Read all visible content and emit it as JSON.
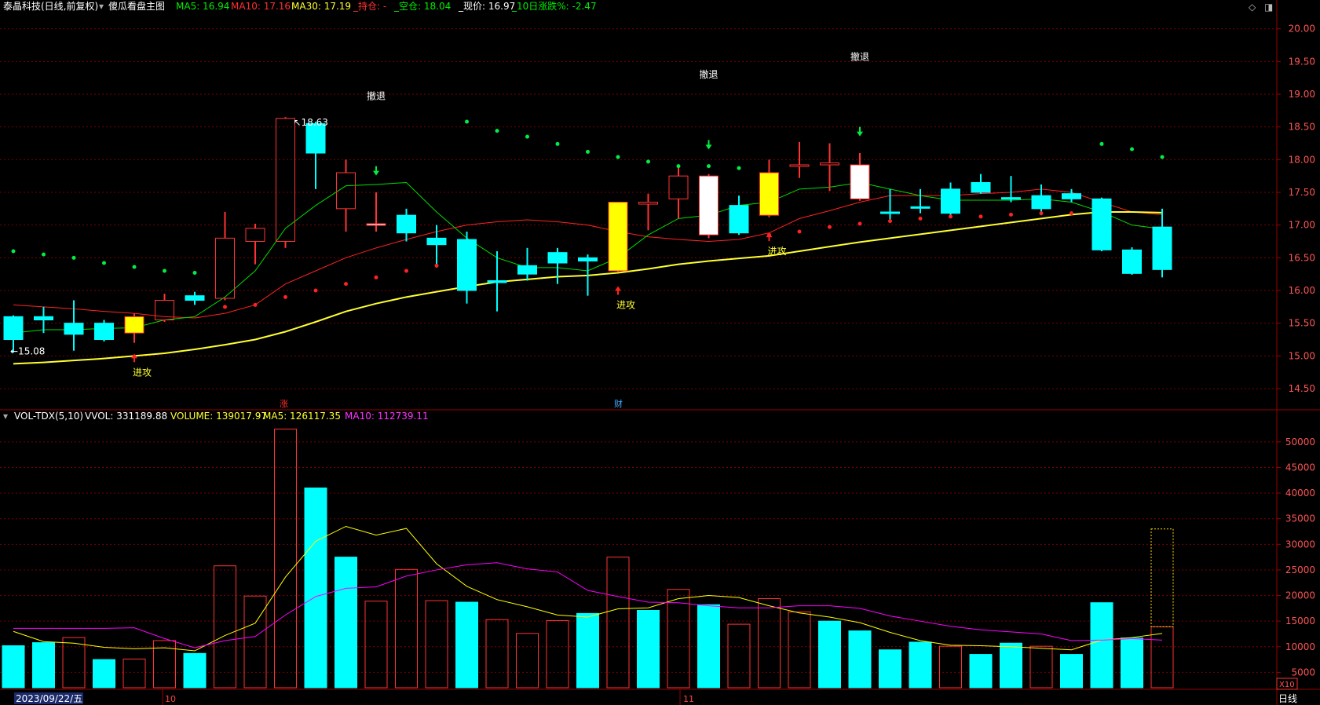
{
  "header": {
    "stock_name": "泰晶科技(日线,前复权)",
    "indicator_name": "傻瓜看盘主图",
    "ma5": "MA5: 16.94",
    "ma10": "MA10: 17.16",
    "ma30": "MA30: 17.19",
    "hold": "_持仓: -",
    "short": "_空仓: 18.04",
    "price": "_现价: 16.97",
    "change10": "_10日涨跌%: -2.47"
  },
  "volume_header": {
    "name": "VOL-TDX(5,10)",
    "vvol": "VVOL: 331189.88",
    "volume": "VOLUME: 139017.97",
    "ma5": "MA5: 126117.35",
    "ma10": "MA10: 112739.11"
  },
  "x_labels": {
    "date": "2023/09/22/五",
    "oct": "10",
    "nov": "11"
  },
  "period_label": "日线",
  "scale_label": "X10",
  "markers": {
    "zhang": "涨",
    "cai": "财"
  },
  "colors": {
    "up": "#ff3333",
    "down": "#00ffff",
    "ma5": "#00dd00",
    "ma10": "#ff2222",
    "ma30": "#ffff33",
    "vol_ma5": "#ffff00",
    "vol_ma10": "#ff00ff",
    "grid": "#7a0000",
    "text": "#ffffff"
  },
  "chart_data": [
    {
      "type": "candlestick",
      "ylim": [
        14.2,
        20.2
      ],
      "yticks": [
        "20.00",
        "19.50",
        "19.00",
        "18.50",
        "18.00",
        "17.50",
        "17.00",
        "16.50",
        "16.00",
        "15.50",
        "15.00",
        "14.50"
      ],
      "candles": [
        {
          "o": 15.6,
          "h": 15.62,
          "l": 15.05,
          "c": 15.25,
          "hl": "down"
        },
        {
          "o": 15.6,
          "h": 15.75,
          "l": 15.35,
          "c": 15.55,
          "hl": "down"
        },
        {
          "o": 15.5,
          "h": 15.85,
          "l": 15.08,
          "c": 15.33,
          "hl": "down"
        },
        {
          "o": 15.5,
          "h": 15.55,
          "l": 15.22,
          "c": 15.25,
          "hl": "down"
        },
        {
          "o": 15.35,
          "h": 15.65,
          "l": 15.2,
          "c": 15.6,
          "hl": "yellow"
        },
        {
          "o": 15.55,
          "h": 15.95,
          "l": 15.52,
          "c": 15.85,
          "hl": "up"
        },
        {
          "o": 15.92,
          "h": 15.98,
          "l": 15.78,
          "c": 15.85,
          "hl": "down"
        },
        {
          "o": 15.88,
          "h": 17.2,
          "l": 15.85,
          "c": 16.8,
          "hl": "up"
        },
        {
          "o": 16.75,
          "h": 17.02,
          "l": 16.4,
          "c": 16.95,
          "hl": "up"
        },
        {
          "o": 16.75,
          "h": 18.65,
          "l": 16.65,
          "c": 18.63,
          "hl": "up"
        },
        {
          "o": 18.55,
          "h": 18.58,
          "l": 17.55,
          "c": 18.1,
          "hl": "down"
        },
        {
          "o": 17.25,
          "h": 18.0,
          "l": 16.9,
          "c": 17.8,
          "hl": "up"
        },
        {
          "o": 17.02,
          "h": 17.5,
          "l": 16.9,
          "c": 17.02,
          "hl": "white"
        },
        {
          "o": 17.15,
          "h": 17.25,
          "l": 16.75,
          "c": 16.88,
          "hl": "down"
        },
        {
          "o": 16.8,
          "h": 17.0,
          "l": 16.35,
          "c": 16.7,
          "hl": "down"
        },
        {
          "o": 16.78,
          "h": 16.9,
          "l": 15.8,
          "c": 16.0,
          "hl": "down"
        },
        {
          "o": 16.15,
          "h": 16.6,
          "l": 15.68,
          "c": 16.12,
          "hl": "down"
        },
        {
          "o": 16.38,
          "h": 16.65,
          "l": 16.15,
          "c": 16.25,
          "hl": "down"
        },
        {
          "o": 16.58,
          "h": 16.65,
          "l": 16.1,
          "c": 16.42,
          "hl": "down"
        },
        {
          "o": 16.5,
          "h": 16.55,
          "l": 15.92,
          "c": 16.45,
          "hl": "down"
        },
        {
          "o": 16.3,
          "h": 17.35,
          "l": 16.28,
          "c": 17.35,
          "hl": "yellow"
        },
        {
          "o": 17.35,
          "h": 17.48,
          "l": 16.92,
          "c": 17.32,
          "hl": "up"
        },
        {
          "o": 17.4,
          "h": 17.9,
          "l": 17.1,
          "c": 17.75,
          "hl": "up"
        },
        {
          "o": 17.75,
          "h": 17.78,
          "l": 16.8,
          "c": 16.85,
          "hl": "white"
        },
        {
          "o": 17.3,
          "h": 17.45,
          "l": 16.85,
          "c": 16.88,
          "hl": "down"
        },
        {
          "o": 17.15,
          "h": 18.0,
          "l": 17.12,
          "c": 17.8,
          "hl": "yellow"
        },
        {
          "o": 17.9,
          "h": 18.27,
          "l": 17.72,
          "c": 17.92,
          "hl": "up"
        },
        {
          "o": 17.92,
          "h": 18.25,
          "l": 17.52,
          "c": 17.95,
          "hl": "up"
        },
        {
          "o": 17.92,
          "h": 18.1,
          "l": 17.37,
          "c": 17.4,
          "hl": "white"
        },
        {
          "o": 17.2,
          "h": 17.55,
          "l": 17.05,
          "c": 17.2,
          "hl": "down"
        },
        {
          "o": 17.28,
          "h": 17.55,
          "l": 17.18,
          "c": 17.26,
          "hl": "down"
        },
        {
          "o": 17.55,
          "h": 17.65,
          "l": 17.15,
          "c": 17.18,
          "hl": "down"
        },
        {
          "o": 17.65,
          "h": 17.78,
          "l": 17.48,
          "c": 17.5,
          "hl": "down"
        },
        {
          "o": 17.42,
          "h": 17.75,
          "l": 17.35,
          "c": 17.41,
          "hl": "down"
        },
        {
          "o": 17.45,
          "h": 17.62,
          "l": 17.15,
          "c": 17.25,
          "hl": "down"
        },
        {
          "o": 17.48,
          "h": 17.55,
          "l": 17.35,
          "c": 17.4,
          "hl": "down"
        },
        {
          "o": 17.4,
          "h": 17.42,
          "l": 16.6,
          "c": 16.62,
          "hl": "down"
        },
        {
          "o": 16.62,
          "h": 16.66,
          "l": 16.24,
          "c": 16.26,
          "hl": "down"
        },
        {
          "o": 16.32,
          "h": 17.25,
          "l": 16.2,
          "c": 16.97,
          "hl": "down"
        }
      ],
      "ma5": [
        15.35,
        15.4,
        15.4,
        15.42,
        15.43,
        15.55,
        15.6,
        15.9,
        16.3,
        16.95,
        17.3,
        17.6,
        17.62,
        17.65,
        17.2,
        16.8,
        16.5,
        16.35,
        16.35,
        16.3,
        16.5,
        16.85,
        17.1,
        17.15,
        17.3,
        17.35,
        17.55,
        17.58,
        17.65,
        17.55,
        17.45,
        17.38,
        17.38,
        17.38,
        17.4,
        17.35,
        17.2,
        17.0,
        16.94
      ],
      "ma10": [
        15.78,
        15.75,
        15.72,
        15.68,
        15.65,
        15.6,
        15.58,
        15.65,
        15.78,
        16.1,
        16.3,
        16.5,
        16.65,
        16.78,
        16.9,
        17.0,
        17.05,
        17.08,
        17.05,
        17.0,
        16.9,
        16.82,
        16.78,
        16.75,
        16.78,
        16.88,
        17.1,
        17.22,
        17.35,
        17.45,
        17.45,
        17.45,
        17.48,
        17.5,
        17.55,
        17.5,
        17.35,
        17.2,
        17.16
      ],
      "ma30": [
        14.88,
        14.9,
        14.93,
        14.96,
        15.0,
        15.04,
        15.1,
        15.17,
        15.25,
        15.37,
        15.52,
        15.68,
        15.8,
        15.9,
        15.98,
        16.06,
        16.13,
        16.17,
        16.21,
        16.23,
        16.27,
        16.33,
        16.4,
        16.45,
        16.49,
        16.53,
        16.6,
        16.67,
        16.74,
        16.8,
        16.86,
        16.92,
        16.98,
        17.04,
        17.1,
        17.16,
        17.2,
        17.2,
        17.19
      ],
      "dots": [
        {
          "i": 0,
          "v": 16.6,
          "c": "g"
        },
        {
          "i": 1,
          "v": 16.55,
          "c": "g"
        },
        {
          "i": 2,
          "v": 16.5,
          "c": "g"
        },
        {
          "i": 3,
          "v": 16.42,
          "c": "g"
        },
        {
          "i": 4,
          "v": 16.36,
          "c": "g"
        },
        {
          "i": 5,
          "v": 16.3,
          "c": "g"
        },
        {
          "i": 6,
          "v": 16.27,
          "c": "g"
        },
        {
          "i": 7,
          "v": 15.75,
          "c": "r"
        },
        {
          "i": 8,
          "v": 15.78,
          "c": "r"
        },
        {
          "i": 9,
          "v": 15.9,
          "c": "r"
        },
        {
          "i": 10,
          "v": 16.0,
          "c": "r"
        },
        {
          "i": 11,
          "v": 16.1,
          "c": "r"
        },
        {
          "i": 12,
          "v": 16.2,
          "c": "r"
        },
        {
          "i": 13,
          "v": 16.3,
          "c": "r"
        },
        {
          "i": 14,
          "v": 16.38,
          "c": "r"
        },
        {
          "i": 15,
          "v": 18.58,
          "c": "g"
        },
        {
          "i": 16,
          "v": 18.44,
          "c": "g"
        },
        {
          "i": 17,
          "v": 18.35,
          "c": "g"
        },
        {
          "i": 18,
          "v": 18.24,
          "c": "g"
        },
        {
          "i": 19,
          "v": 18.12,
          "c": "g"
        },
        {
          "i": 20,
          "v": 18.04,
          "c": "g"
        },
        {
          "i": 21,
          "v": 17.97,
          "c": "g"
        },
        {
          "i": 22,
          "v": 17.9,
          "c": "g"
        },
        {
          "i": 23,
          "v": 17.9,
          "c": "g"
        },
        {
          "i": 24,
          "v": 17.87,
          "c": "g"
        },
        {
          "i": 25,
          "v": 16.85,
          "c": "r"
        },
        {
          "i": 26,
          "v": 16.9,
          "c": "r"
        },
        {
          "i": 27,
          "v": 16.97,
          "c": "r"
        },
        {
          "i": 28,
          "v": 17.02,
          "c": "r"
        },
        {
          "i": 29,
          "v": 17.06,
          "c": "r"
        },
        {
          "i": 30,
          "v": 17.1,
          "c": "r"
        },
        {
          "i": 31,
          "v": 17.13,
          "c": "r"
        },
        {
          "i": 32,
          "v": 17.13,
          "c": "r"
        },
        {
          "i": 33,
          "v": 17.16,
          "c": "r"
        },
        {
          "i": 34,
          "v": 17.18,
          "c": "r"
        },
        {
          "i": 35,
          "v": 17.18,
          "c": "r"
        },
        {
          "i": 36,
          "v": 18.24,
          "c": "g"
        },
        {
          "i": 37,
          "v": 18.16,
          "c": "g"
        },
        {
          "i": 38,
          "v": 18.04,
          "c": "g"
        }
      ],
      "annotations": [
        {
          "i": 4,
          "text": "进攻",
          "v": 14.7,
          "kind": "up"
        },
        {
          "i": 12,
          "text": "撤退",
          "v": 18.92,
          "kind": "label"
        },
        {
          "i": 12,
          "text": "",
          "v": 17.9,
          "kind": "down"
        },
        {
          "i": 20,
          "text": "进攻",
          "v": 15.73,
          "kind": "up"
        },
        {
          "i": 23,
          "text": "撤退",
          "v": 19.25,
          "kind": "label"
        },
        {
          "i": 23,
          "text": "",
          "v": 18.3,
          "kind": "down"
        },
        {
          "i": 25,
          "text": "进攻",
          "v": 16.55,
          "kind": "up"
        },
        {
          "i": 28,
          "text": "撤退",
          "v": 19.52,
          "kind": "label"
        },
        {
          "i": 28,
          "text": "",
          "v": 18.5,
          "kind": "down"
        }
      ],
      "high_label": "18.63",
      "low_label": "15.08"
    },
    {
      "type": "bar",
      "ylim": [
        2000,
        53500
      ],
      "yticks": [
        "50000",
        "45000",
        "40000",
        "35000",
        "30000",
        "25000",
        "20000",
        "15000",
        "10000",
        "5000"
      ],
      "volumes": [
        10200,
        10800,
        11800,
        7500,
        7600,
        11200,
        8700,
        25800,
        19900,
        52500,
        41000,
        27500,
        18900,
        25100,
        19000,
        18700,
        15300,
        12600,
        15100,
        16500,
        27500,
        17100,
        21200,
        18200,
        14400,
        19400,
        16800,
        15000,
        13100,
        9400,
        10900,
        10100,
        8500,
        10700,
        10100,
        8500,
        18600,
        11700,
        13900
      ],
      "dir": [
        "d",
        "d",
        "u",
        "d",
        "u",
        "u",
        "d",
        "u",
        "u",
        "u",
        "d",
        "d",
        "u",
        "u",
        "u",
        "d",
        "u",
        "u",
        "u",
        "d",
        "u",
        "d",
        "u",
        "d",
        "u",
        "u",
        "u",
        "d",
        "d",
        "d",
        "d",
        "u",
        "d",
        "d",
        "u",
        "d",
        "d",
        "d",
        "u"
      ],
      "forecast": 33000,
      "vol_ma5": [
        13000,
        11000,
        10700,
        9900,
        9600,
        9800,
        9200,
        12200,
        14600,
        23600,
        30600,
        33500,
        31800,
        33100,
        26200,
        21800,
        19200,
        17800,
        16200,
        15800,
        17400,
        17600,
        19400,
        20000,
        19600,
        18000,
        16600,
        15800,
        14700,
        12800,
        11200,
        10300,
        10200,
        10000,
        9700,
        9400,
        11300,
        11800,
        12600
      ],
      "vol_ma10": [
        13600,
        13600,
        13600,
        13600,
        13700,
        11600,
        9800,
        11200,
        12000,
        16200,
        19800,
        21400,
        21700,
        23800,
        25000,
        26000,
        26400,
        25200,
        24600,
        21000,
        19800,
        18700,
        18600,
        18000,
        17600,
        17600,
        18000,
        18000,
        17500,
        16000,
        15000,
        14000,
        13300,
        12900,
        12500,
        11200,
        11300,
        11600,
        11300
      ]
    }
  ]
}
